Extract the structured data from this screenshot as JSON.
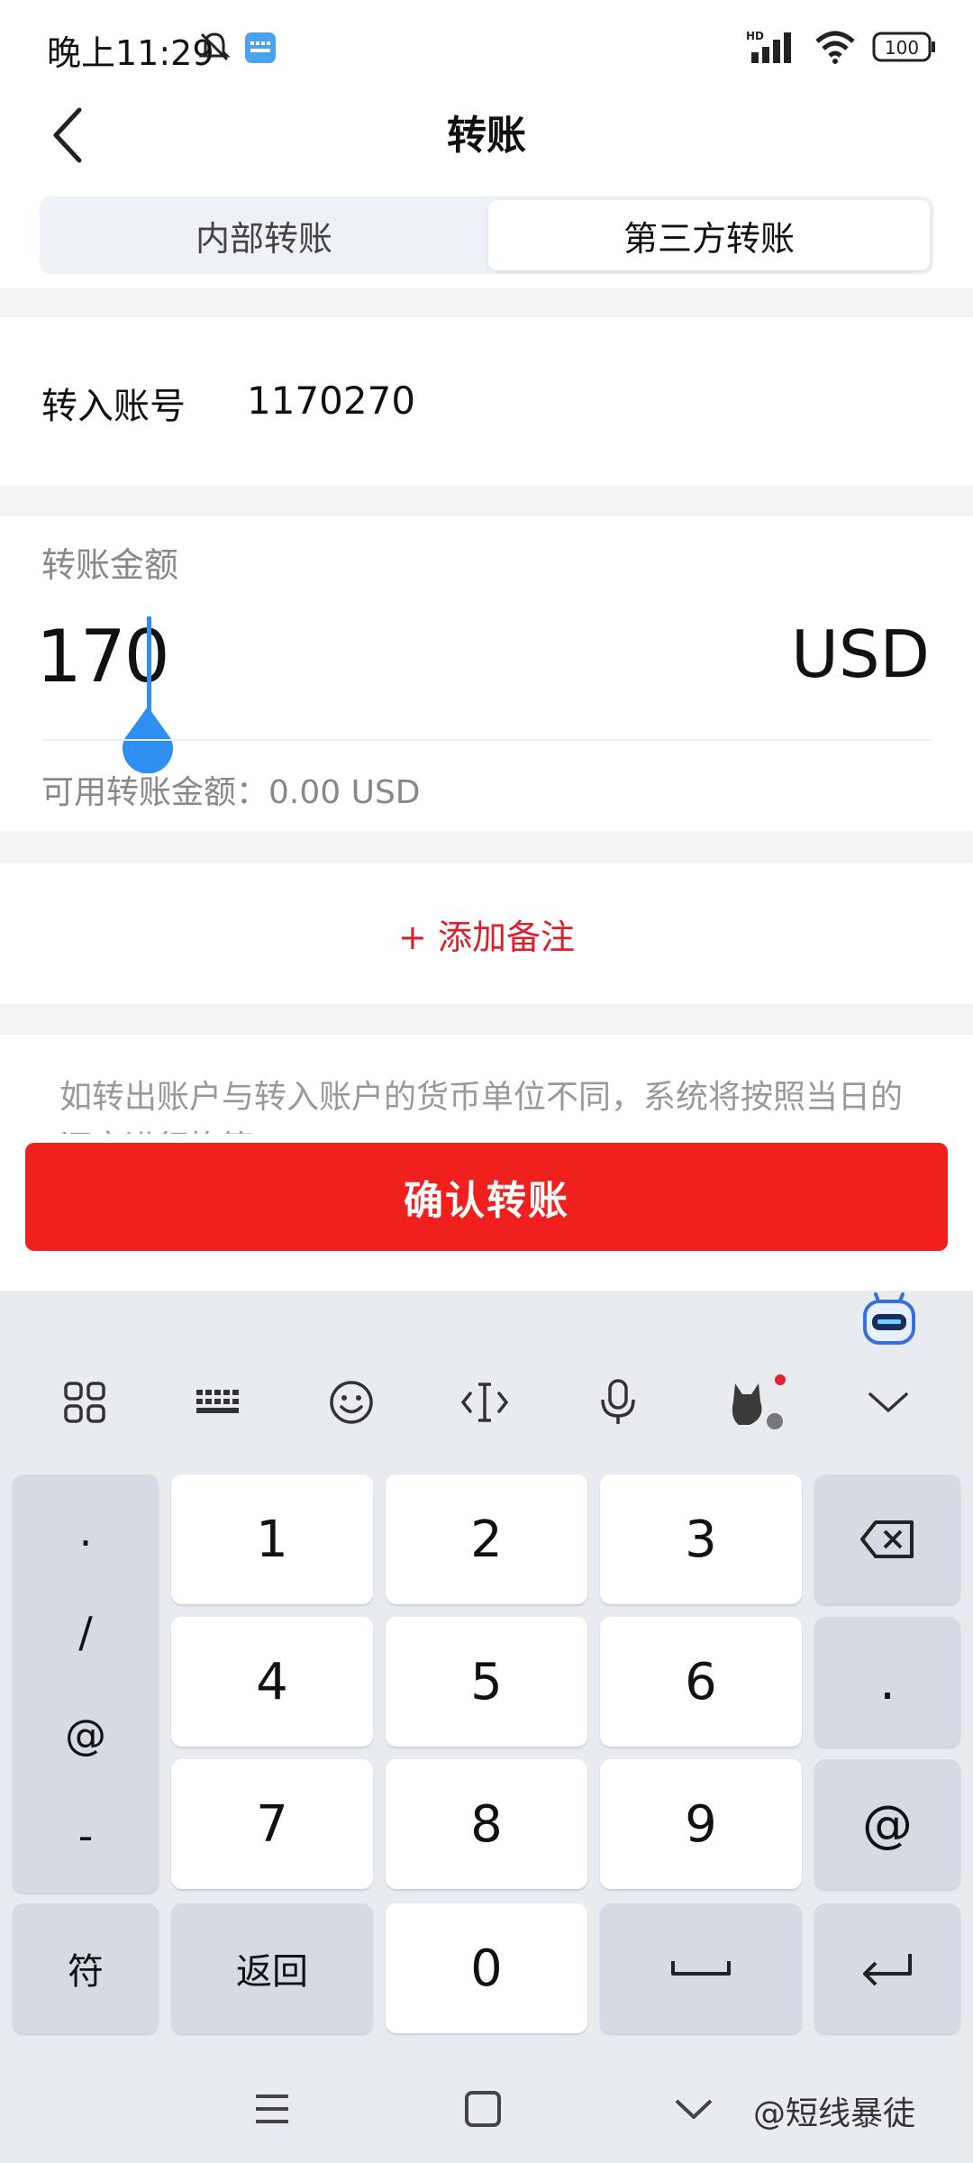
{
  "status_bar": {
    "time": "晚上11:29",
    "network": "HD",
    "battery": "100"
  },
  "header": {
    "title": "转账"
  },
  "tabs": [
    {
      "label": "内部转账",
      "selected": false
    },
    {
      "label": "第三方转账",
      "selected": true
    }
  ],
  "account": {
    "label": "转入账号",
    "value": "1170270"
  },
  "amount": {
    "label": "转账金额",
    "value": "170",
    "currency": "USD",
    "available": "可用转账金额：0.00 USD"
  },
  "note": {
    "label": "+ 添加备注"
  },
  "tip": {
    "text": "如转出账户与转入账户的货币单位不同，系统将按照当日的汇率进行换算。"
  },
  "confirm": {
    "label": "确认转账"
  },
  "keyboard": {
    "toolbar": [
      "apps-grid-icon",
      "keyboard-icon",
      "emoji-icon",
      "cursor-move-icon",
      "microphone-icon",
      "cat-avatar-icon",
      "collapse-icon"
    ],
    "symbols": [
      ".",
      "/",
      "@",
      "-"
    ],
    "digits": [
      "1",
      "2",
      "3",
      "4",
      "5",
      "6",
      "7",
      "8",
      "9",
      "0"
    ],
    "right_keys": {
      "dot": ".",
      "at": "@"
    },
    "bottom": {
      "symbols": "符",
      "back": "返回"
    }
  },
  "navbar": {
    "watermark": "@短线暴徒"
  },
  "colors": {
    "accent_red": "#f0201f",
    "note_red": "#d9202c",
    "cursor_blue": "#2e8ff0"
  }
}
